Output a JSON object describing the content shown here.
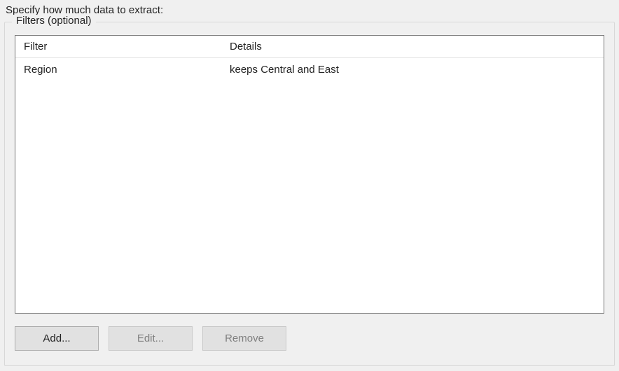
{
  "instruction": "Specify how much data to extract:",
  "fieldset": {
    "legend": "Filters (optional)",
    "columns": {
      "filter": "Filter",
      "details": "Details"
    },
    "rows": [
      {
        "filter": "Region",
        "details": "keeps Central and East"
      }
    ]
  },
  "buttons": {
    "add": "Add...",
    "edit": "Edit...",
    "remove": "Remove"
  }
}
